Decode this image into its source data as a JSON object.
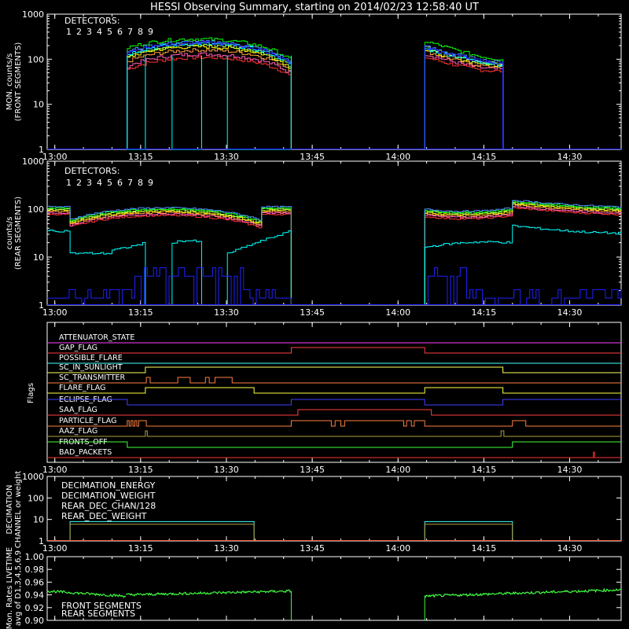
{
  "title": "HESSI Observing Summary, starting on 2014/02/23 12:58:40 UT",
  "colors": {
    "background": "#000000",
    "axes": "#ffffff",
    "det": [
      "#ff3030",
      "#ff5ab8",
      "#ffa040",
      "#ffff00",
      "#a0ff50",
      "#00ff00",
      "#00ffff",
      "#5090ff",
      "#2020ff"
    ]
  },
  "chart_data": [
    {
      "type": "line",
      "panel": "front",
      "ylabel": "MON. counts/s\n(FRONT SEGMENTS)",
      "yscale": "log",
      "ylim": [
        1,
        1000
      ],
      "ytick_labels": [
        "1",
        "10",
        "100",
        "1000"
      ],
      "xlim": [
        "12:58:40",
        "14:39:00"
      ],
      "xtick_labels": [
        "13:00",
        "13:15",
        "13:30",
        "13:45",
        "14:00",
        "14:15",
        "14:30"
      ],
      "legend_title": "DETECTORS:",
      "legend_labels": [
        "1",
        "2",
        "3",
        "4",
        "5",
        "6",
        "7",
        "8",
        "9"
      ],
      "segments": [
        [
          "13:12:40",
          "13:41:20"
        ],
        [
          "14:04:40",
          "14:18:20"
        ]
      ],
      "series": [
        {
          "name": "1",
          "level": [
            [
              60,
              110,
              40
            ],
            [
              110,
              70,
              55
            ]
          ]
        },
        {
          "name": "2",
          "level": [
            [
              70,
              130,
              45
            ],
            [
              130,
              80,
              60
            ]
          ]
        },
        {
          "name": "3",
          "level": [
            [
              90,
              160,
              55
            ],
            [
              150,
              90,
              70
            ]
          ]
        },
        {
          "name": "4",
          "level": [
            [
              110,
              190,
              60
            ],
            [
              160,
              100,
              75
            ]
          ]
        },
        {
          "name": "5",
          "level": [
            [
              120,
              210,
              65
            ],
            [
              180,
              110,
              80
            ]
          ]
        },
        {
          "name": "6",
          "level": [
            [
              180,
              280,
              90
            ],
            [
              250,
              150,
              100
            ]
          ]
        },
        {
          "name": "7",
          "level": [
            [
              130,
              220,
              70
            ],
            [
              170,
              110,
              75
            ]
          ]
        },
        {
          "name": "8",
          "level": [
            [
              150,
              240,
              80
            ],
            [
              190,
              120,
              85
            ]
          ]
        },
        {
          "name": "9",
          "level": [
            [
              140,
              230,
              75
            ],
            [
              180,
              115,
              80
            ]
          ]
        }
      ],
      "detector7_gaps": [
        [
          "13:12:40",
          "13:15:50"
        ],
        [
          "13:20:30",
          "13:25:40"
        ],
        [
          "13:30:10",
          "13:41:20"
        ]
      ]
    },
    {
      "type": "line",
      "panel": "rear",
      "ylabel": "counts/s\n(REAR SEGMENTS)",
      "yscale": "log",
      "ylim": [
        1,
        1000
      ],
      "ytick_labels": [
        "1",
        "10",
        "100",
        "1000"
      ],
      "xtick_labels": [
        "13:00",
        "13:15",
        "13:30",
        "13:45",
        "14:00",
        "14:15",
        "14:30"
      ],
      "legend_title": "DETECTORS:",
      "legend_labels": [
        "1",
        "2",
        "3",
        "4",
        "5",
        "6",
        "7",
        "8",
        "9"
      ],
      "high_group_levels": {
        "start": 95,
        "mid": 90,
        "end": 65,
        "sec2_start": 85,
        "sec2_end": 90,
        "jump_level": 130
      },
      "det7_levels": {
        "start": 35,
        "dip": 12,
        "mid": 20,
        "sec2": 20,
        "after_jump": 45
      },
      "det9_levels": {
        "low": 1.4,
        "mid": 4
      }
    },
    {
      "type": "table",
      "panel": "flags",
      "ylabel": "Flags",
      "xtick_labels": [
        "13:00",
        "13:15",
        "13:30",
        "13:45",
        "14:00",
        "14:15",
        "14:30"
      ],
      "flags": [
        {
          "name": "ATTENUATOR_STATE",
          "color": "#ff40ff"
        },
        {
          "name": "GAP_FLAG",
          "color": "#ff4040"
        },
        {
          "name": "POSSIBLE_FLARE",
          "color": "#40ffff"
        },
        {
          "name": "SC_IN_SUNLIGHT",
          "color": "#ffff60"
        },
        {
          "name": "SC_TRANSMITTER",
          "color": "#ff8040"
        },
        {
          "name": "FLARE_FLAG",
          "color": "#ffff40"
        },
        {
          "name": "ECLIPSE_FLAG",
          "color": "#4040ff"
        },
        {
          "name": "SAA_FLAG",
          "color": "#ff4040"
        },
        {
          "name": "PARTICLE_FLAG",
          "color": "#ff8040"
        },
        {
          "name": "AAZ_FLAG",
          "color": "#b0a040"
        },
        {
          "name": "FRONTS_OFF",
          "color": "#40ff40"
        },
        {
          "name": "BAD_PACKETS",
          "color": "#ff3030"
        }
      ]
    },
    {
      "type": "line",
      "panel": "decimation",
      "ylabel": "DECIMATION\nCHANNEL or weight",
      "yscale": "log",
      "ylim": [
        1,
        1000
      ],
      "ytick_labels": [
        "1",
        "10",
        "100",
        "1000"
      ],
      "xtick_labels": [
        "13:00",
        "13:15",
        "13:30",
        "13:45",
        "14:00",
        "14:15",
        "14:30"
      ],
      "legend_labels": [
        "DECIMATION_ENERGY",
        "DECIMATION_WEIGHT",
        "REAR_DEC_CHAN/128",
        "REAR_DEC_WEIGHT"
      ],
      "legend_colors": [
        "#40ff40",
        "#ff6040",
        "#40ffff",
        "#b0a040"
      ],
      "rear_dec_chan_level": 8,
      "rear_dec_weight_level": 6
    },
    {
      "type": "line",
      "panel": "livetime",
      "ylabel": "Mon. Rates LIVETIME\navg of D1,3,4,5,6,9",
      "ylim": [
        0.9,
        1.0
      ],
      "ytick_labels": [
        "0.90",
        "0.92",
        "0.94",
        "0.96",
        "0.98",
        "1.00"
      ],
      "legend_labels": [
        "FRONT SEGMENTS",
        "REAR SEGMENTS"
      ],
      "legend_colors": [
        "#40ff40",
        "#208020"
      ],
      "segments": [
        [
          "12:58:40",
          "13:41:20"
        ],
        [
          "14:04:40",
          "14:39:00"
        ]
      ],
      "values": [
        0.946,
        0.938,
        0.948
      ]
    }
  ]
}
